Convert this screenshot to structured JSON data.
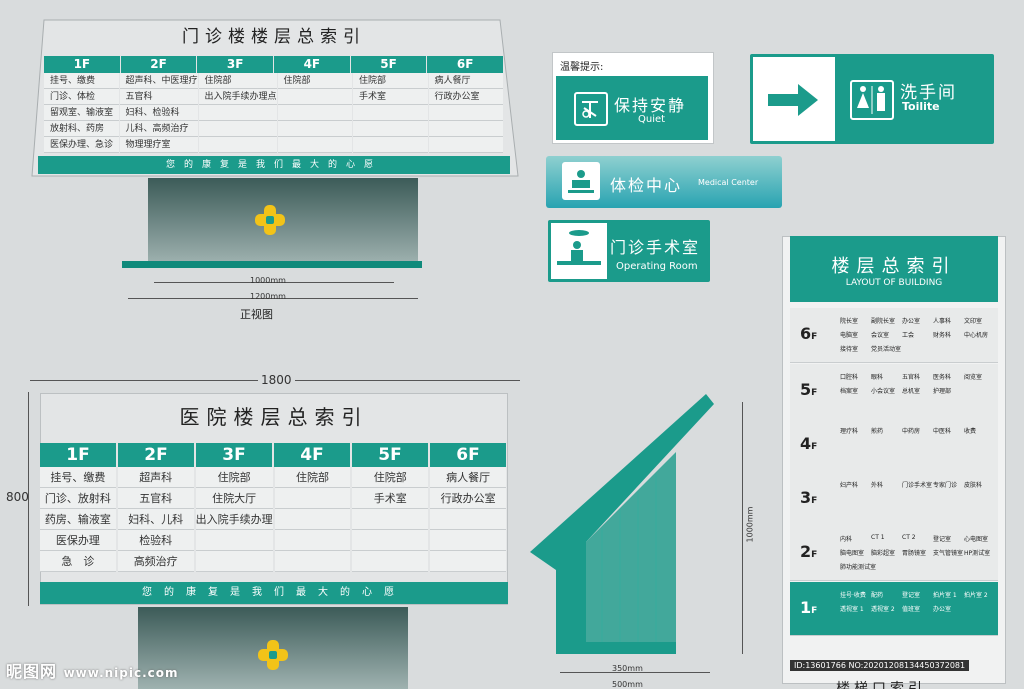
{
  "sign1": {
    "title": "门诊楼楼层总索引",
    "floors": [
      "1F",
      "2F",
      "3F",
      "4F",
      "5F",
      "6F"
    ],
    "columns": [
      [
        "挂号、缴费",
        "门诊、体检",
        "留观室、输液室",
        "放射科、药房",
        "医保办理、急诊"
      ],
      [
        "超声科、中医理疗",
        "五官科",
        "妇科、检验科",
        "儿科、高频治疗",
        "物理理疗室"
      ],
      [
        "住院部",
        "出入院手续办理点",
        "",
        "",
        ""
      ],
      [
        "住院部",
        "",
        "",
        "",
        ""
      ],
      [
        "住院部",
        "手术室",
        "",
        "",
        ""
      ],
      [
        "病人餐厅",
        "行政办公室",
        "",
        "",
        ""
      ]
    ],
    "slogan": "您的康复是我们最大的心愿",
    "dim_inner": "1000mm",
    "dim_outer": "1200mm",
    "view_label": "正视图"
  },
  "sign2": {
    "width_label": "1800",
    "height_label": "800",
    "title": "医院楼层总索引",
    "floors": [
      "1F",
      "2F",
      "3F",
      "4F",
      "5F",
      "6F"
    ],
    "columns": [
      [
        "挂号、缴费",
        "门诊、放射科",
        "药房、输液室",
        "医保办理",
        "急　诊"
      ],
      [
        "超声科",
        "五官科",
        "妇科、儿科",
        "检验科",
        "高频治疗"
      ],
      [
        "住院部",
        "住院大厅",
        "出入院手续办理",
        "",
        ""
      ],
      [
        "住院部",
        "",
        "",
        "",
        ""
      ],
      [
        "住院部",
        "手术室",
        "",
        "",
        ""
      ],
      [
        "病人餐厅",
        "行政办公室",
        "",
        "",
        ""
      ]
    ],
    "slogan": "您的康复是我们最大的心愿"
  },
  "notice": {
    "title": "温馨提示:",
    "cn": "保持安静",
    "en": "Quiet"
  },
  "medical": {
    "cn": "体检中心",
    "en": "Medical Center"
  },
  "operating": {
    "cn": "门诊手术室",
    "en": "Operating Room"
  },
  "washroom": {
    "cn": "洗手间",
    "en": "Toilite"
  },
  "stand": {
    "dim_height": "1000mm",
    "dim_top": "350mm",
    "dim_bottom": "500mm"
  },
  "building": {
    "title": "楼层总索引",
    "subtitle": "LAYOUT OF BUILDING",
    "floors": [
      {
        "num": "6",
        "rooms": [
          "院长室",
          "副院长室",
          "办公室",
          "人事科",
          "文印室",
          "电脑室",
          "会议室",
          "工会",
          "财务科",
          "中心机房",
          "接待室",
          "党员活动室"
        ]
      },
      {
        "num": "5",
        "rooms": [
          "口腔科",
          "眼科",
          "五官科",
          "医务科",
          "阅览室",
          "档案室",
          "小会议室",
          "总机室",
          "护理部"
        ]
      },
      {
        "num": "4",
        "rooms": [
          "理疗科",
          "煎药",
          "中药房",
          "中医科",
          "收费"
        ]
      },
      {
        "num": "3",
        "rooms": [
          "妇产科",
          "外科",
          "门诊手术室",
          "专家门诊",
          "皮肤科"
        ]
      },
      {
        "num": "2",
        "rooms": [
          "内科",
          "CT 1",
          "CT 2",
          "登记室",
          "心电图室",
          "脑电图室",
          "脑彩超室",
          "胃肠镜室",
          "支气管镜室",
          "HP测试室",
          "肺功能测试室"
        ]
      },
      {
        "num": "1",
        "rooms": [
          "挂号·收费",
          "配药",
          "登记室",
          "拍片室 1",
          "拍片室 2",
          "透视室 1",
          "透视室 2",
          "值班室",
          "办公室"
        ]
      }
    ],
    "id_text": "ID:13601766 NO:20201208134450372081",
    "caption": "楼梯口索引"
  },
  "watermark": {
    "main": "昵图网",
    "url": "www.nipic.com"
  },
  "colors": {
    "teal": "#1b9b8b",
    "accent": "#f2c318",
    "background": "#d9dcdd"
  }
}
